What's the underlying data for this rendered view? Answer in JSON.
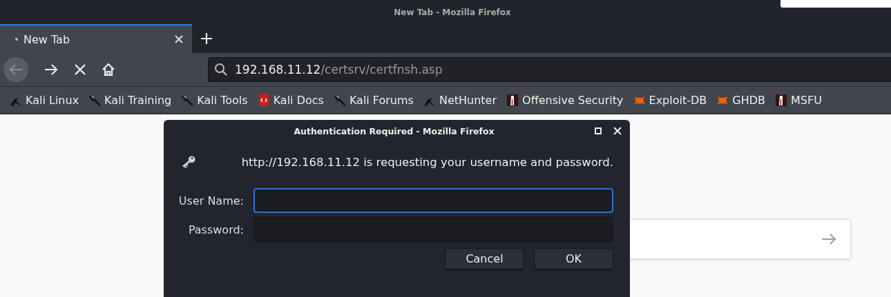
{
  "window": {
    "title": "New Tab - Mozilla Firefox"
  },
  "tabs": [
    {
      "label": "New Tab",
      "selected": true
    }
  ],
  "navigation": {
    "back_disabled": true
  },
  "address_bar": {
    "host": "192.168.11.12",
    "path": "/certsrv/certfnsh.asp"
  },
  "bookmarks": [
    {
      "label": "Kali Linux",
      "kind": "kali"
    },
    {
      "label": "Kali Training",
      "kind": "dagger"
    },
    {
      "label": "Kali Tools",
      "kind": "dagger"
    },
    {
      "label": "Kali Docs",
      "kind": "docs"
    },
    {
      "label": "Kali Forums",
      "kind": "dagger"
    },
    {
      "label": "NetHunter",
      "kind": "kali"
    },
    {
      "label": "Offensive Security",
      "kind": "offsec"
    },
    {
      "label": "Exploit-DB",
      "kind": "bug"
    },
    {
      "label": "GHDB",
      "kind": "bug"
    },
    {
      "label": "MSFU",
      "kind": "offsec"
    }
  ],
  "dialog": {
    "title": "Authentication Required - Mozilla Firefox",
    "message": "http://192.168.11.12 is requesting your username and password.",
    "fields": [
      {
        "label": "User Name:",
        "focused": true
      },
      {
        "label": "Password:",
        "focused": false
      }
    ],
    "buttons": [
      "Cancel",
      "OK"
    ]
  }
}
